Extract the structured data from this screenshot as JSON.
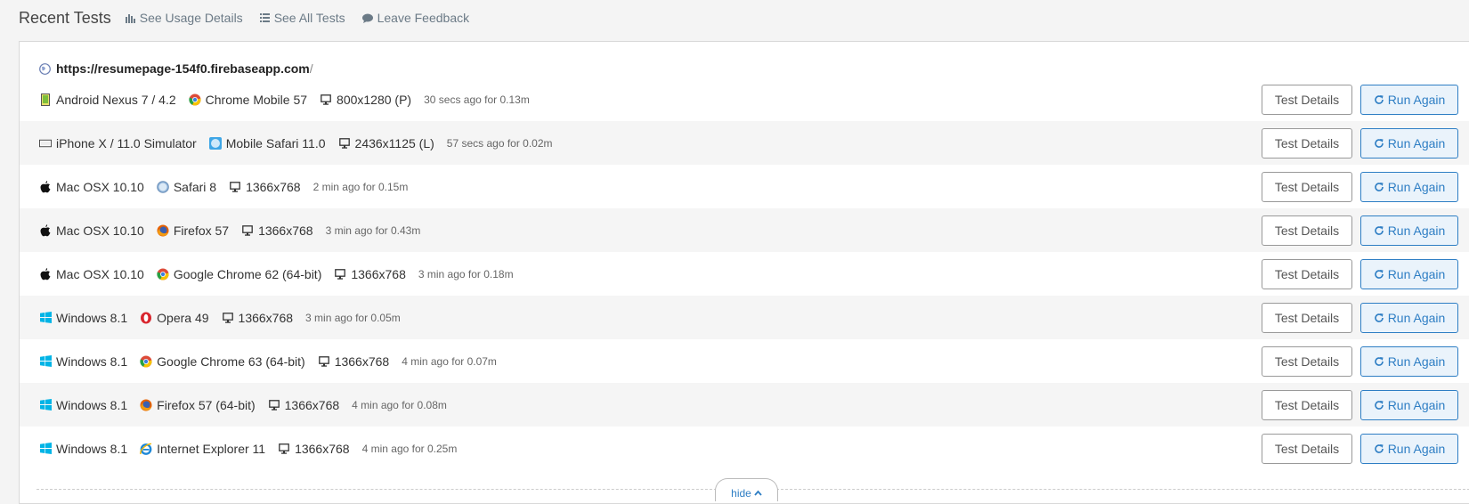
{
  "header": {
    "title": "Recent Tests",
    "links": [
      {
        "label": "See Usage Details",
        "icon": "bar-chart-icon"
      },
      {
        "label": "See All Tests",
        "icon": "list-icon"
      },
      {
        "label": "Leave Feedback",
        "icon": "comment-icon"
      }
    ]
  },
  "panel": {
    "url": "https://resumepage-154f0.firebaseapp.com",
    "url_suffix": "/",
    "hide_label": "hide"
  },
  "buttons": {
    "details_label": "Test Details",
    "run_label": "Run Again"
  },
  "tests": [
    {
      "os": "Android Nexus 7 / 4.2",
      "os_icon": "android-tablet-icon",
      "browser": "Chrome Mobile 57",
      "browser_icon": "chrome-icon",
      "resolution": "800x1280 (P)",
      "meta": "30 secs ago for 0.13m"
    },
    {
      "os": "iPhone X / 11.0 Simulator",
      "os_icon": "iphone-landscape-icon",
      "browser": "Mobile Safari 11.0",
      "browser_icon": "mobile-safari-icon",
      "resolution": "2436x1125 (L)",
      "meta": "57 secs ago for 0.02m"
    },
    {
      "os": "Mac OSX 10.10",
      "os_icon": "apple-icon",
      "browser": "Safari 8",
      "browser_icon": "safari-icon",
      "resolution": "1366x768",
      "meta": "2 min ago for 0.15m"
    },
    {
      "os": "Mac OSX 10.10",
      "os_icon": "apple-icon",
      "browser": "Firefox 57",
      "browser_icon": "firefox-icon",
      "resolution": "1366x768",
      "meta": "3 min ago for 0.43m"
    },
    {
      "os": "Mac OSX 10.10",
      "os_icon": "apple-icon",
      "browser": "Google Chrome 62 (64-bit)",
      "browser_icon": "chrome-icon",
      "resolution": "1366x768",
      "meta": "3 min ago for 0.18m"
    },
    {
      "os": "Windows 8.1",
      "os_icon": "windows-icon",
      "browser": "Opera 49",
      "browser_icon": "opera-icon",
      "resolution": "1366x768",
      "meta": "3 min ago for 0.05m"
    },
    {
      "os": "Windows 8.1",
      "os_icon": "windows-icon",
      "browser": "Google Chrome 63 (64-bit)",
      "browser_icon": "chrome-icon",
      "resolution": "1366x768",
      "meta": "4 min ago for 0.07m"
    },
    {
      "os": "Windows 8.1",
      "os_icon": "windows-icon",
      "browser": "Firefox 57 (64-bit)",
      "browser_icon": "firefox-icon",
      "resolution": "1366x768",
      "meta": "4 min ago for 0.08m"
    },
    {
      "os": "Windows 8.1",
      "os_icon": "windows-icon",
      "browser": "Internet Explorer 11",
      "browser_icon": "ie-icon",
      "resolution": "1366x768",
      "meta": "4 min ago for 0.25m"
    }
  ],
  "colors": {
    "accent": "#2e7ec4",
    "row_alt": "#f5f5f5",
    "windows": "#00b4e6"
  }
}
